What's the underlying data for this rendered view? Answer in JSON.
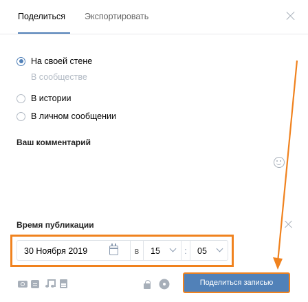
{
  "tabs": {
    "share": "Поделиться",
    "export": "Экспортировать"
  },
  "share_targets": {
    "wall": "На своей стене",
    "community": "В сообществе",
    "story": "В истории",
    "message": "В личном сообщении"
  },
  "comment": {
    "label": "Ваш комментарий",
    "value": ""
  },
  "publish_time": {
    "label": "Время публикации",
    "date": "30 Ноября 2019",
    "at": "в",
    "hour": "15",
    "separator": ":",
    "minute": "05"
  },
  "footer": {
    "share_button": "Поделиться записью"
  },
  "colors": {
    "accent": "#5181b8",
    "highlight": "#f0821e"
  }
}
